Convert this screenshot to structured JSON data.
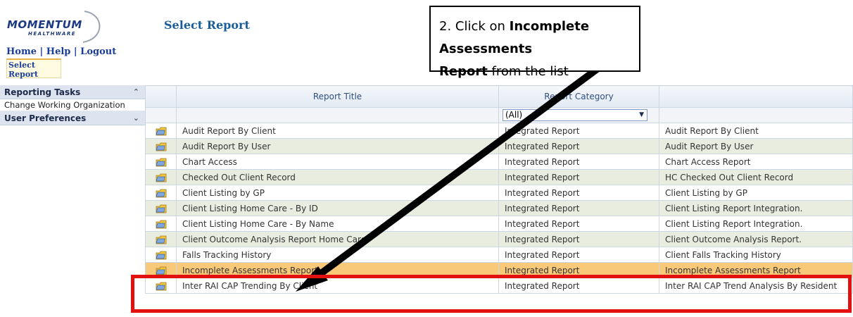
{
  "brand": {
    "logo_text": "MOMENTUM",
    "logo_sub": "HEALTHWARE"
  },
  "topnav": {
    "home": "Home",
    "help": "Help",
    "logout": "Logout",
    "sep": "|"
  },
  "tab": {
    "label": "Select Report"
  },
  "page_title": "Select Report",
  "sidebar": {
    "reporting_tasks": "Reporting Tasks",
    "change_org": "Change Working Organization",
    "user_preferences": "User Preferences"
  },
  "grid": {
    "headers": {
      "title": "Report Title",
      "category": "Report Category",
      "description": ""
    },
    "filter_value": "(All)",
    "rows": [
      {
        "title": "Audit Report By Client",
        "category": "Integrated Report",
        "description": "Audit Report By Client"
      },
      {
        "title": "Audit Report By User",
        "category": "Integrated Report",
        "description": "Audit Report By User"
      },
      {
        "title": "Chart Access",
        "category": "Integrated Report",
        "description": "Chart Access Report"
      },
      {
        "title": "Checked Out Client Record",
        "category": "Integrated Report",
        "description": "HC Checked Out Client Record"
      },
      {
        "title": "Client Listing by GP",
        "category": "Integrated Report",
        "description": "Client Listing by GP"
      },
      {
        "title": "Client Listing Home Care - By ID",
        "category": "Integrated Report",
        "description": "Client Listing Report Integration."
      },
      {
        "title": "Client Listing Home Care - By Name",
        "category": "Integrated Report",
        "description": "Client Listing Report Integration."
      },
      {
        "title": "Client Outcome Analysis Report Home Care",
        "category": "Integrated Report",
        "description": "Client Outcome Analysis Report."
      },
      {
        "title": "Falls Tracking History",
        "category": "Integrated Report",
        "description": "Client Falls Tracking History"
      },
      {
        "title": "Incomplete Assessments Report",
        "category": "Integrated Report",
        "description": "Incomplete Assessments Report"
      },
      {
        "title": "Inter RAI CAP Trending By Client",
        "category": "Integrated Report",
        "description": "Inter RAI CAP Trend Analysis By Resident"
      }
    ],
    "selected_index": 9
  },
  "callout": {
    "prefix": "2. Click on ",
    "bold1": "Incomplete Assessments",
    "bold2": "Report",
    "suffix": " from the list"
  },
  "colors": {
    "accent": "#1a3d99",
    "selected_row": "#f9c97a",
    "alt_row": "#e9ede0",
    "highlight_box": "#e31010"
  },
  "icons": {
    "row_icon": "report-folder-icon",
    "expand": "chevron-up-icon",
    "collapse": "chevron-down-icon"
  }
}
